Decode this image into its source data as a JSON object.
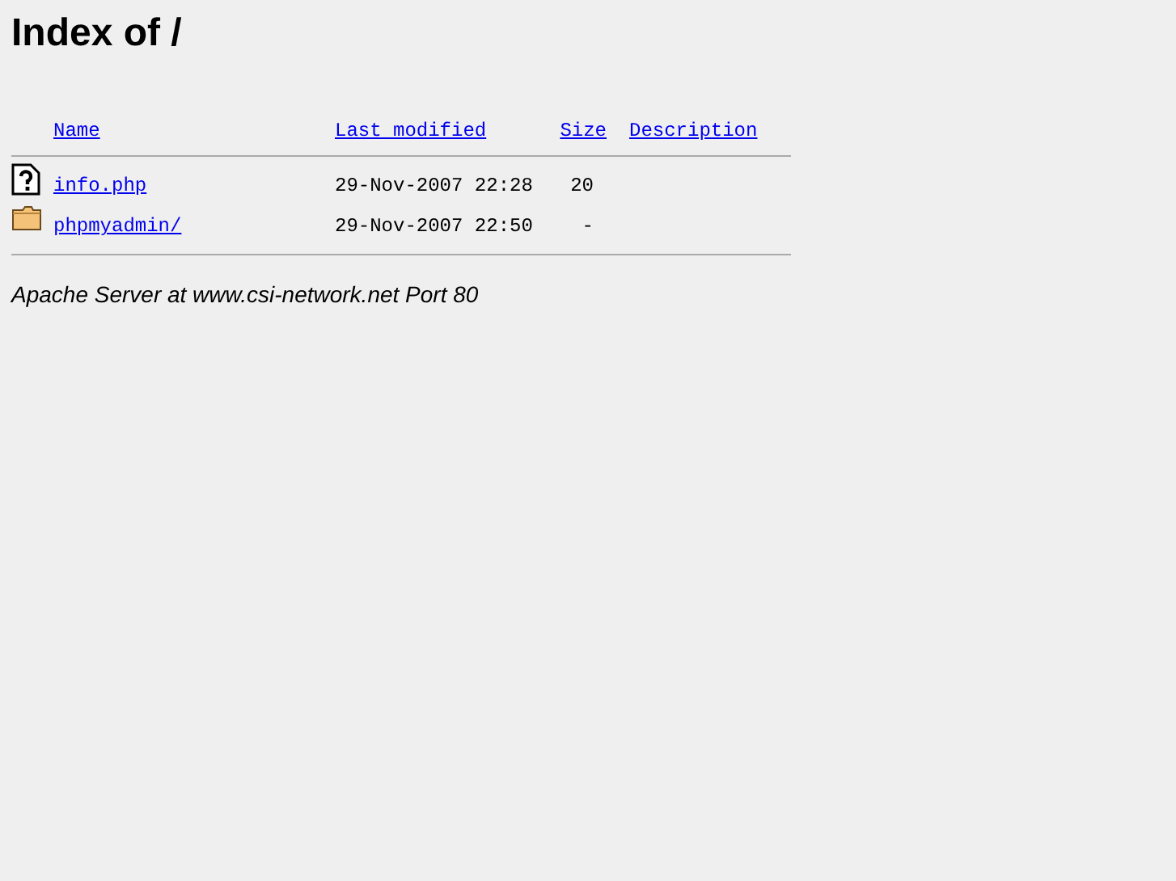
{
  "title": "Index of /",
  "columns": [
    "Name",
    "Last modified",
    "Size",
    "Description"
  ],
  "rows": [
    {
      "kind": "file",
      "name": "info.php",
      "modified": "29-Nov-2007 22:28",
      "size": "20"
    },
    {
      "kind": "folder",
      "name": "phpmyadmin/",
      "modified": "29-Nov-2007 22:50",
      "size": "-"
    }
  ],
  "footer": "Apache Server at www.csi-network.net Port 80"
}
